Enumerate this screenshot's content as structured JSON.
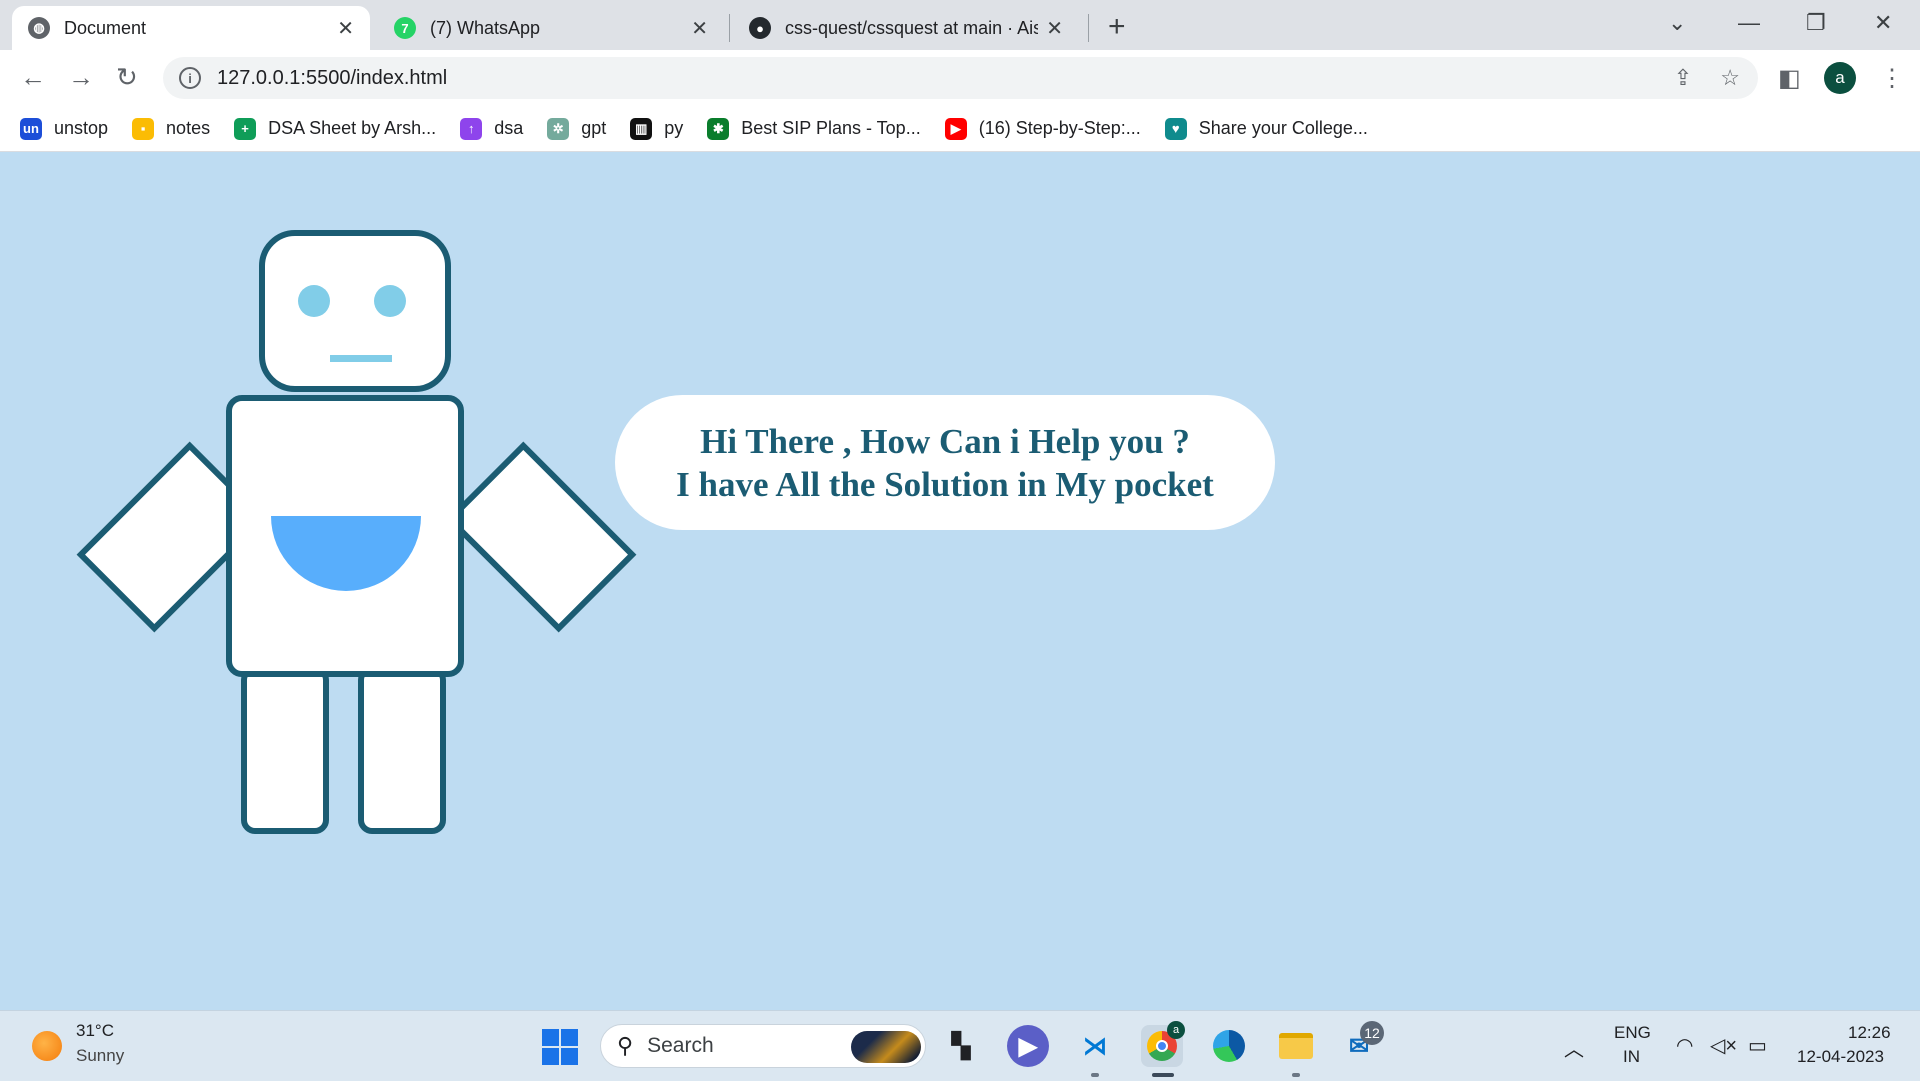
{
  "tabs": [
    {
      "title": "Document",
      "icon": "globe-icon",
      "active": true
    },
    {
      "title": "(7) WhatsApp",
      "icon": "whatsapp-icon"
    },
    {
      "title": "css-quest/cssquest at main · Aish",
      "icon": "github-icon"
    }
  ],
  "address_bar": {
    "url": "127.0.0.1:5500/index.html"
  },
  "profile": {
    "initial": "a"
  },
  "bookmarks": [
    {
      "label": "unstop",
      "icon": "unstop-icon",
      "color": "#1d4ed8",
      "glyph": "un"
    },
    {
      "label": "notes",
      "icon": "keep-notes-icon",
      "color": "#fbbc04",
      "glyph": "▪"
    },
    {
      "label": "DSA Sheet by Arsh...",
      "icon": "sheets-icon",
      "color": "#0f9d58",
      "glyph": "+"
    },
    {
      "label": "dsa",
      "icon": "dsa-icon",
      "color": "#8e44ec",
      "glyph": "↑"
    },
    {
      "label": "gpt",
      "icon": "openai-icon",
      "color": "#74aa9c",
      "glyph": "✲"
    },
    {
      "label": "py",
      "icon": "py-icon",
      "color": "#111111",
      "glyph": "▥"
    },
    {
      "label": "Best SIP Plans - Top...",
      "icon": "sip-icon",
      "color": "#0a7d2c",
      "glyph": "✱"
    },
    {
      "label": "(16) Step-by-Step:...",
      "icon": "youtube-icon",
      "color": "#ff0000",
      "glyph": "▶"
    },
    {
      "label": "Share your College...",
      "icon": "share-icon",
      "color": "#0f8b8d",
      "glyph": "♥"
    }
  ],
  "page": {
    "speech_line1": "Hi There , How Can i Help you ?",
    "speech_line2": "I have All the Solution in My pocket",
    "colors": {
      "background": "#bedcf2",
      "outline": "#1b5c73",
      "eyes": "#81cde8",
      "pocket": "#58aefc"
    }
  },
  "taskbar": {
    "weather_temp": "31°C",
    "weather_condition": "Sunny",
    "search_label": "Search",
    "mail_badge": "12",
    "language": "ENG",
    "region": "IN",
    "time": "12:26",
    "date": "12-04-2023",
    "chrome_badge": "a"
  }
}
